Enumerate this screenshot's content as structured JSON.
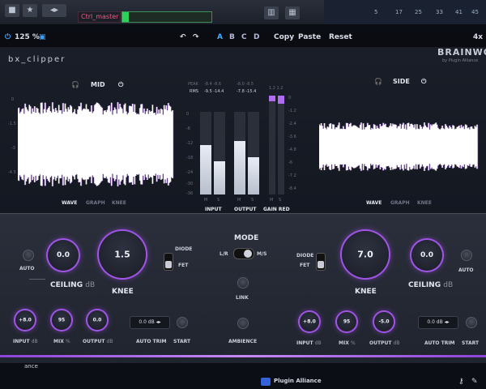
{
  "daw": {
    "track_name": "Ctrl_master",
    "timeline_numbers": [
      "5",
      "17",
      "25",
      "33",
      "41",
      "45"
    ]
  },
  "header": {
    "zoom": "125 %",
    "presets": [
      "A",
      "B",
      "C",
      "D"
    ],
    "copy_label": "Copy",
    "paste_label": "Paste",
    "reset_label": "Reset",
    "oversample": "4x"
  },
  "plugin": {
    "name": "bx_clipper",
    "brand": "BRAINWORX",
    "brand_sub": "by Plugin Alliance"
  },
  "mid": {
    "title": "MID",
    "tabs": [
      "WAVE",
      "GRAPH",
      "KNEE"
    ],
    "axis": [
      "0",
      "-1.5",
      "-3",
      "-4.5",
      "-6"
    ]
  },
  "side": {
    "title": "SIDE",
    "tabs": [
      "WAVE",
      "GRAPH",
      "KNEE"
    ]
  },
  "meters": {
    "peak_label": "PEAK",
    "rms_label": "RMS",
    "input_peak": "-8.4  -8.6",
    "input_rms": "-9.5  -14.4",
    "output_peak": "-8.0  -8.5",
    "output_rms": "-7.8  -15.4",
    "gr_peak": "1.2  1.2",
    "scale": [
      "0",
      "-6",
      "-12",
      "-18",
      "-24",
      "-30",
      "-36"
    ],
    "gr_scale": [
      "0",
      "-1.2",
      "-2.4",
      "-3.6",
      "-4.8",
      "-6",
      "-7.2",
      "-8.4"
    ],
    "input_label": "INPUT",
    "output_label": "OUTPUT",
    "gr_label": "GAIN RED",
    "ms": [
      "M",
      "S"
    ],
    "input_levels": [
      0.6,
      0.4
    ],
    "output_levels": [
      0.65,
      0.45
    ],
    "gr_levels": [
      0.06,
      0.08
    ]
  },
  "left": {
    "auto": "AUTO",
    "ceiling_value": "0.0",
    "ceiling_label": "CEILING",
    "ceiling_unit": "dB",
    "knee_value": "1.5",
    "knee_label": "KNEE",
    "diode": "DIODE",
    "fet": "FET",
    "input_value": "+8.0",
    "input_label": "INPUT",
    "input_unit": "dB",
    "mix_value": "95",
    "mix_label": "MIX",
    "mix_unit": "%",
    "output_value": "0.0",
    "output_label": "OUTPUT",
    "output_unit": "dB",
    "trim_value": "0.0 dB",
    "trim_label": "AUTO TRIM",
    "start": "START"
  },
  "center": {
    "mode": "MODE",
    "lr": "L/R",
    "ms": "M/S",
    "link": "LINK",
    "ambience": "AMBIENCE"
  },
  "right": {
    "auto": "AUTO",
    "ceiling_value": "0.0",
    "ceiling_label": "CEILING",
    "ceiling_unit": "dB",
    "knee_value": "7.0",
    "knee_label": "KNEE",
    "diode": "DIODE",
    "fet": "FET",
    "input_value": "+8.0",
    "input_label": "INPUT",
    "input_unit": "dB",
    "mix_value": "95",
    "mix_label": "MIX",
    "mix_unit": "%",
    "output_value": "-5.0",
    "output_label": "OUTPUT",
    "output_unit": "dB",
    "trim_value": "0.0 dB",
    "trim_label": "AUTO TRIM",
    "start": "START"
  },
  "taskbar": {
    "plugin_alliance": "Plugin Alliance",
    "left_fragment": "ance"
  },
  "colors": {
    "accent": "#a055e8",
    "waveform": "#ffffff",
    "background": "#141821"
  }
}
